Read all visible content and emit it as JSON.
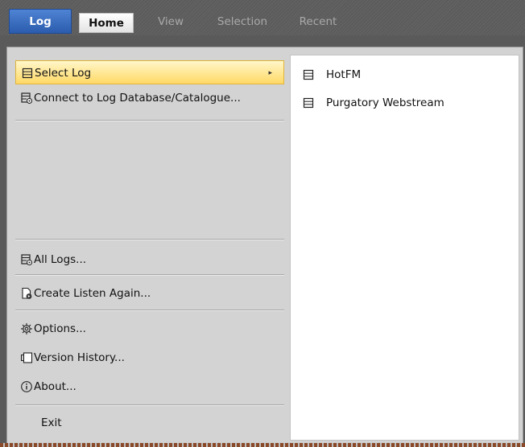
{
  "ribbon": {
    "tabs": [
      {
        "label": "Log",
        "active": true
      },
      {
        "label": "Home",
        "active": false
      },
      {
        "label": "View",
        "active": false
      },
      {
        "label": "Selection",
        "active": false
      },
      {
        "label": "Recent",
        "active": false
      }
    ]
  },
  "log_menu": {
    "items": [
      {
        "label": "Select Log",
        "icon": "log-list-icon",
        "selected": true,
        "has_submenu": true
      },
      {
        "label": "Connect to Log Database/Catalogue...",
        "icon": "log-database-icon"
      },
      {
        "label": "All Logs...",
        "icon": "log-database-icon"
      },
      {
        "label": "Create Listen Again...",
        "icon": "listen-again-icon"
      },
      {
        "label": "Options...",
        "icon": "gear-icon"
      },
      {
        "label": "Version History...",
        "icon": "version-history-icon"
      },
      {
        "label": "About...",
        "icon": "info-icon"
      },
      {
        "label": "Exit"
      }
    ]
  },
  "select_log_submenu": {
    "items": [
      {
        "label": "HotFM",
        "icon": "log-list-icon"
      },
      {
        "label": "Purgatory Webstream",
        "icon": "log-list-icon"
      }
    ]
  },
  "colors": {
    "active_tab": "#3a6cc0",
    "selected_item": "#ffd966"
  }
}
